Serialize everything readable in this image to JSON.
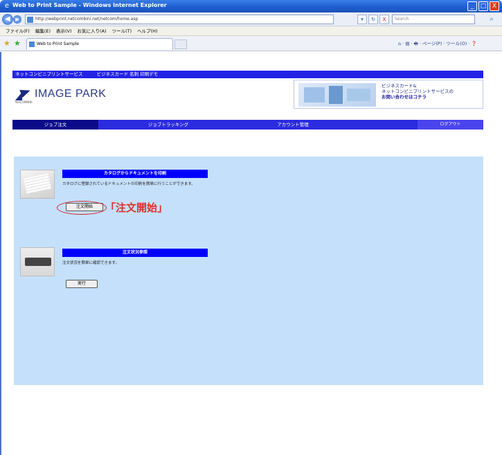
{
  "window": {
    "title": "Web to Print Sample - Windows Internet Explorer",
    "minimize_symbol": "_",
    "maximize_symbol": "□",
    "close_symbol": "X"
  },
  "addressbar": {
    "back_symbol": "◀",
    "forward_symbol": "▶",
    "url": "http://webprint.netcombini.net/netcom/home.asp",
    "refresh_symbol": "↻",
    "stop_symbol": "X",
    "search_placeholder": "Search",
    "search_icon": "search-icon",
    "search_symbol": "⌕"
  },
  "menubar": {
    "items": [
      "ファイル(F)",
      "編集(E)",
      "表示(V)",
      "お気に入り(A)",
      "ツール(T)",
      "ヘルプ(H)"
    ]
  },
  "favbar": {
    "tab_label": "Web to Print Sample",
    "star_symbol": "★",
    "toolbar_text": "⌂ · ▤ · 🖶 · ページ(P) · ツール(O) · ❓"
  },
  "site": {
    "nav_items": [
      "ネットコンビニプリントサービス",
      "ビジネスカード 名刺 印刷デモ"
    ],
    "logo_text": "IMAGE PARK",
    "logo_sub": "NetCOMBINI",
    "banner_line1": "ビジネスカード&",
    "banner_line2": "ネットコンビニプリントサービスの",
    "banner_line3": "お問い合わせはコチラ"
  },
  "main_tabs": [
    {
      "label": "ジョブ注文",
      "active": true
    },
    {
      "label": "ジョブトラッキング",
      "active": false
    },
    {
      "label": "アカウント管理",
      "active": false
    }
  ],
  "logout_label": "ログアウト",
  "cards": [
    {
      "header": "カタログからドキュメントを印刷",
      "description": "カタログに登録されているドキュメントの印刷を簡単に行うことができます。",
      "button_label": "注文開始"
    },
    {
      "header": "注文状況参照",
      "description": "注文状況を簡単に確認できます。",
      "button_label": "実行"
    }
  ],
  "annotation": {
    "text": "「注文開始」",
    "color": "#e0302a"
  },
  "colors": {
    "title_bar": "#1f5fd0",
    "site_nav": "#2323e6",
    "main_tabs": "#2b2be0",
    "active_tab": "#0b0b8a",
    "content_bg": "#c5e0fb",
    "card_header": "#0000ff"
  }
}
